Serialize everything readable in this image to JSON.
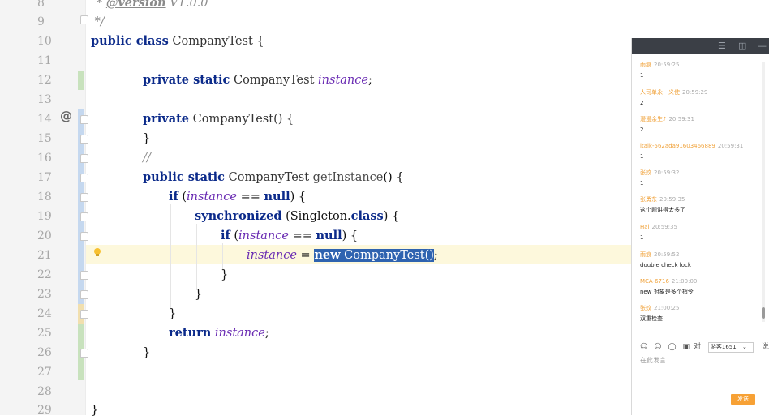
{
  "editor": {
    "lines": [
      {
        "num": "8"
      },
      {
        "num": "9"
      },
      {
        "num": "10"
      },
      {
        "num": "11"
      },
      {
        "num": "12"
      },
      {
        "num": "13"
      },
      {
        "num": "14"
      },
      {
        "num": "15"
      },
      {
        "num": "16"
      },
      {
        "num": "17"
      },
      {
        "num": "18"
      },
      {
        "num": "19"
      },
      {
        "num": "20"
      },
      {
        "num": "21"
      },
      {
        "num": "22"
      },
      {
        "num": "23"
      },
      {
        "num": "24"
      },
      {
        "num": "25"
      },
      {
        "num": "26"
      },
      {
        "num": "27"
      },
      {
        "num": "28"
      },
      {
        "num": "29"
      }
    ],
    "code": {
      "l8_star": "* ",
      "l8_tag": "@version",
      "l8_rest": " V1.0.0",
      "l9": " */",
      "l10_kw": "public class",
      "l10_name": " CompanyTest {",
      "l12_kw": "private static",
      "l12_type": " CompanyTest ",
      "l12_var": "instance",
      "l12_end": ";",
      "l14_kw": "private",
      "l14_rest": " CompanyTest() {",
      "l15": "}",
      "l16": "//",
      "l17_kw": "public static",
      "l17_type": " CompanyTest ",
      "l17_fn": "getInstance",
      "l17_end": "() {",
      "l18_kw": "if",
      "l18_a": " (",
      "l18_var": "instance",
      "l18_b": " == ",
      "l18_null": "null",
      "l18_c": ") {",
      "l19_kw": "synchronized",
      "l19_a": " (Singleton.",
      "l19_cls": "class",
      "l19_b": ") {",
      "l20_kw": "if",
      "l20_a": " (",
      "l20_var": "instance",
      "l20_b": " == ",
      "l20_null": "null",
      "l20_c": ") {",
      "l21_var": "instance",
      "l21_eq": " = ",
      "l21_new": "new",
      "l21_call": " CompanyTest()",
      "l21_end": ";",
      "l22": "}",
      "l23": "}",
      "l24": "}",
      "l25_kw": "return",
      "l25_var": " instance",
      "l25_end": ";",
      "l26": "}",
      "l29": "}"
    },
    "gutter_marker": "@"
  },
  "chat": {
    "messages": [
      {
        "name": "雨痕",
        "time": "20:59:25",
        "text": "1"
      },
      {
        "name": "人司单永一义使",
        "time": "20:59:29",
        "text": "2"
      },
      {
        "name": "漫漫余生♪",
        "time": "20:59:31",
        "text": "2"
      },
      {
        "name": "itaik-562ada91603466889",
        "time": "20:59:31",
        "text": "1"
      },
      {
        "name": "张妏",
        "time": "20:59:32",
        "text": "1"
      },
      {
        "name": "张勇东",
        "time": "20:59:35",
        "text": "这个题讲得太多了"
      },
      {
        "name": "Hai",
        "time": "20:59:35",
        "text": "1"
      },
      {
        "name": "雨痕",
        "time": "20:59:52",
        "text": "double  check  lock"
      },
      {
        "name": "MCA-6716",
        "time": "21:00:00",
        "text": "new  对象是多个指令"
      },
      {
        "name": "张妏",
        "time": "21:00:25",
        "text": "双重检查"
      }
    ],
    "toolbar_label": "对",
    "select_value": "游客1651",
    "toolbar_tail": "说:",
    "input_placeholder": "在此发言",
    "send_label": "发送"
  }
}
